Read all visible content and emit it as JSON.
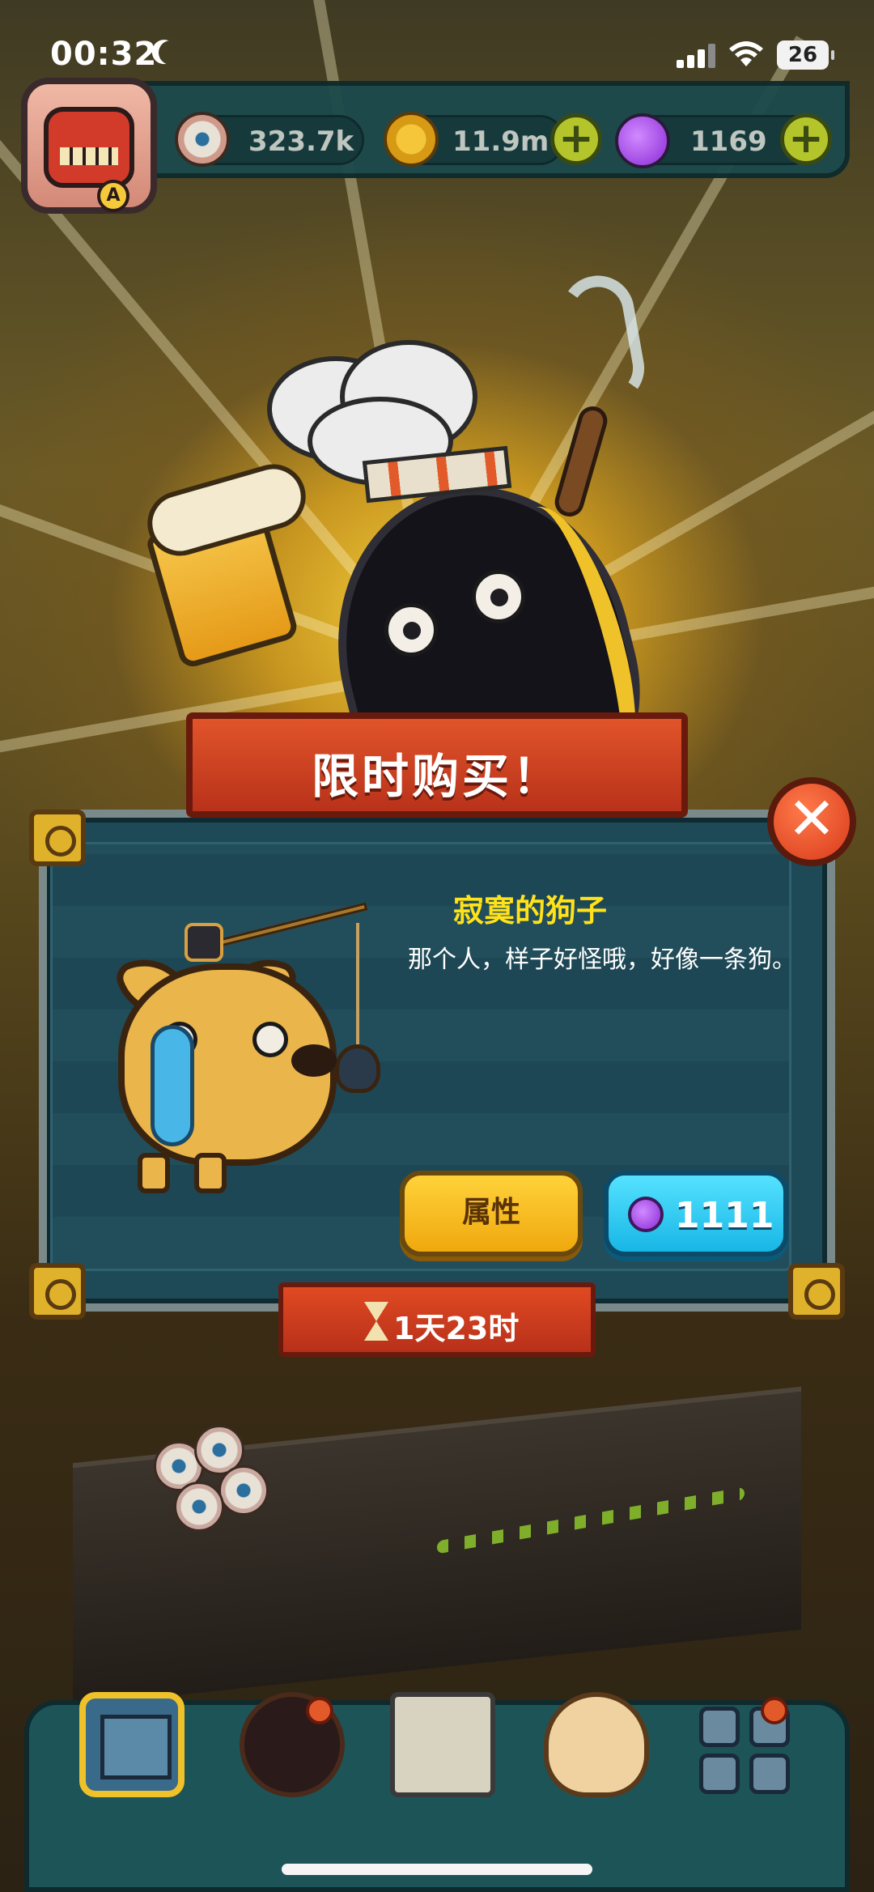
{
  "status_bar": {
    "time": "00:32",
    "battery": "26"
  },
  "resources": [
    {
      "icon": "eyeball-icon",
      "value": "323.7k"
    },
    {
      "icon": "gold-coin-icon",
      "value": "11.9m"
    },
    {
      "icon": "purple-potion-icon",
      "value": "1169"
    }
  ],
  "dialog": {
    "title": "限时购买！",
    "item_name": "寂寞的狗子",
    "item_description": "那个人，样子好怪哦，好像一条狗。",
    "attributes_button": "属性",
    "price": "1111",
    "timer": "1天23时"
  },
  "colors": {
    "accent_yellow": "#ffe21a",
    "ribbon_red": "#d8401e",
    "panel_teal": "#1e4a58",
    "buy_cyan": "#2ec6f0",
    "attr_gold": "#f6b81c"
  },
  "bottom_nav": [
    {
      "icon": "building-icon",
      "selected": true
    },
    {
      "icon": "monster-icon",
      "badge": true
    },
    {
      "icon": "book-icon"
    },
    {
      "icon": "coin-bag-icon"
    },
    {
      "icon": "grid-icon",
      "badge": true
    }
  ]
}
